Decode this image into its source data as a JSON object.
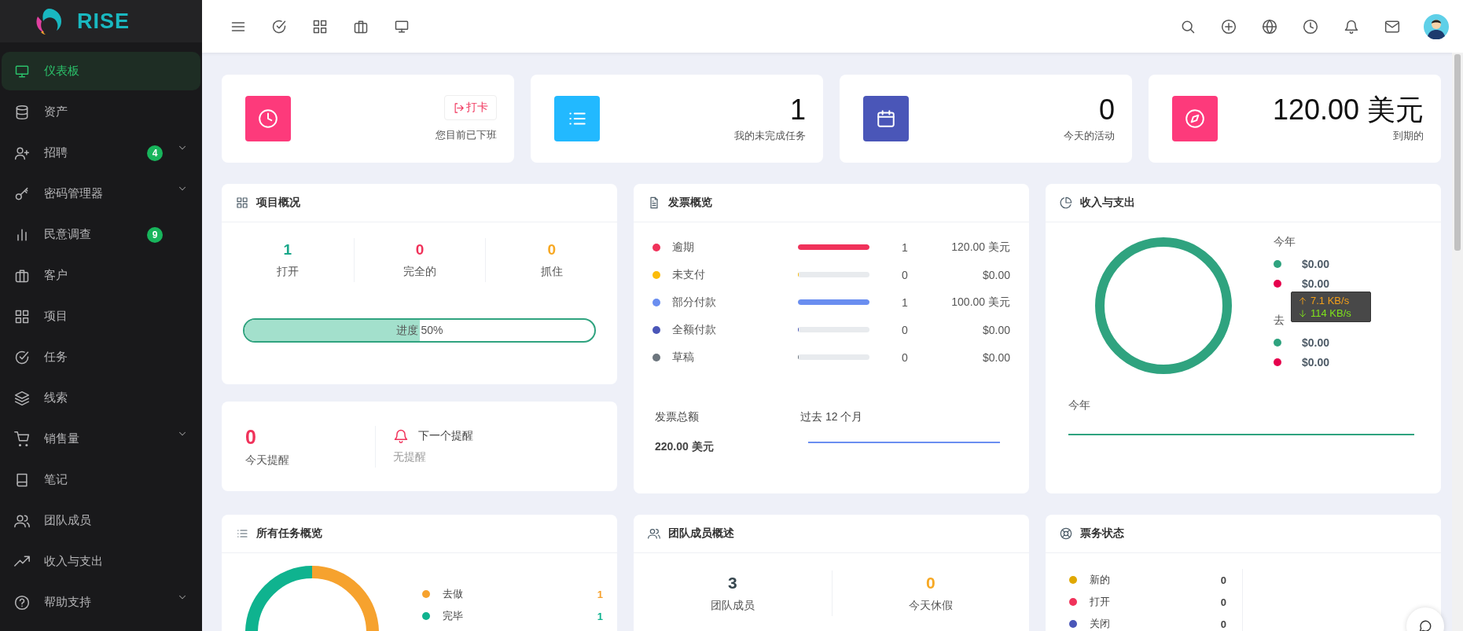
{
  "logo": {
    "text": "RISE"
  },
  "sidebar": {
    "items": [
      {
        "label": "仪表板",
        "selected": true,
        "expandable": false
      },
      {
        "label": "资产",
        "selected": false,
        "expandable": false
      },
      {
        "label": "招聘",
        "selected": false,
        "expandable": true,
        "badge": "4"
      },
      {
        "label": "密码管理器",
        "selected": false,
        "expandable": true
      },
      {
        "label": "民意调查",
        "selected": false,
        "expandable": false,
        "badge": "9"
      },
      {
        "label": "客户",
        "selected": false,
        "expandable": false
      },
      {
        "label": "项目",
        "selected": false,
        "expandable": false
      },
      {
        "label": "任务",
        "selected": false,
        "expandable": false
      },
      {
        "label": "线索",
        "selected": false,
        "expandable": false
      },
      {
        "label": "销售量",
        "selected": false,
        "expandable": true
      },
      {
        "label": "笔记",
        "selected": false,
        "expandable": false
      },
      {
        "label": "团队成员",
        "selected": false,
        "expandable": false
      },
      {
        "label": "收入与支出",
        "selected": false,
        "expandable": false
      },
      {
        "label": "帮助支持",
        "selected": false,
        "expandable": true
      }
    ]
  },
  "stat_cards": [
    {
      "kind": "clock_in",
      "color": "#fd3a7b",
      "button": "打卡",
      "caption": "您目前已下班"
    },
    {
      "kind": "value",
      "color": "#22b9ff",
      "value": "1",
      "caption": "我的未完成任务"
    },
    {
      "kind": "value",
      "color": "#4a56b8",
      "value": "0",
      "caption": "今天的活动"
    },
    {
      "kind": "value",
      "color": "#fd3a7b",
      "value": "120.00 美元",
      "caption": "到期的"
    }
  ],
  "project_overview": {
    "title": "项目概况",
    "stats": [
      {
        "value": "1",
        "label": "打开",
        "color": "#1aa88a"
      },
      {
        "value": "0",
        "label": "完全的",
        "color": "#f0325a"
      },
      {
        "value": "0",
        "label": "抓住",
        "color": "#f7a823"
      }
    ],
    "progress": {
      "label": "进度 50%",
      "level": 0.5
    }
  },
  "reminders": {
    "count": "0",
    "count_label": "今天提醒",
    "next_title": "下一个提醒",
    "next_value": "无提醒"
  },
  "invoice_overview": {
    "title": "发票概览",
    "rows": [
      {
        "label": "逾期",
        "color": "#f0325a",
        "level": 1,
        "count": "1",
        "amount": "120.00 美元"
      },
      {
        "label": "未支付",
        "color": "#fbbc0b",
        "level": 0,
        "count": "0",
        "amount": "$0.00"
      },
      {
        "label": "部分付款",
        "color": "#6a8ef0",
        "level": 1,
        "count": "1",
        "amount": "100.00 美元"
      },
      {
        "label": "全额付款",
        "color": "#4a56b8",
        "level": 0,
        "count": "0",
        "amount": "$0.00"
      },
      {
        "label": "草稿",
        "color": "#6c757d",
        "level": 0,
        "count": "0",
        "amount": "$0.00"
      }
    ],
    "total_label": "发票总额",
    "total": "220.00 美元",
    "period": "过去 12 个月"
  },
  "income_expenses": {
    "title": "收入与支出",
    "this_year_label": "今年",
    "this_year": [
      {
        "color": "#2fa37f",
        "amount": "$0.00"
      },
      {
        "color": "#e6004d",
        "amount": "$0.00"
      }
    ],
    "last_year_label": "去",
    "last_year": [
      {
        "color": "#2fa37f",
        "amount": "$0.00"
      },
      {
        "color": "#e6004d",
        "amount": "$0.00"
      }
    ],
    "chart_label": "今年"
  },
  "network_overlay": {
    "upload": "7.1 KB/s",
    "download": "114 KB/s"
  },
  "tasks_overview": {
    "title": "所有任务概览",
    "rows": [
      {
        "label": "去做",
        "count": "1",
        "color": "#f6a22e"
      },
      {
        "label": "完毕",
        "count": "1",
        "color": "#0fb38f"
      }
    ]
  },
  "team_overview": {
    "title": "团队成员概述",
    "stats": [
      {
        "value": "3",
        "label": "团队成员",
        "color": "#37474f"
      },
      {
        "value": "0",
        "label": "今天休假",
        "color": "#f7a823"
      }
    ]
  },
  "ticket_status": {
    "title": "票务状态",
    "rows": [
      {
        "label": "新的",
        "count": "0",
        "color": "#e0a800"
      },
      {
        "label": "打开",
        "count": "0",
        "color": "#f0325a"
      },
      {
        "label": "关闭",
        "count": "0",
        "color": "#4a56b8"
      }
    ]
  }
}
